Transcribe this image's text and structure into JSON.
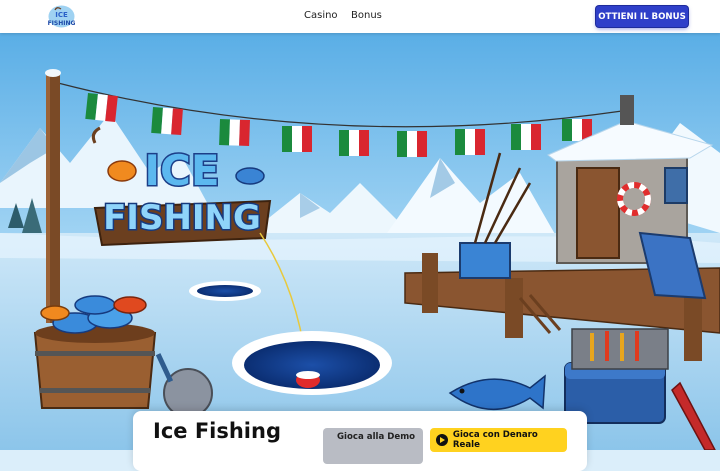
{
  "header": {
    "logo_text": "ICE FISHING",
    "nav": [
      {
        "label": "Casino"
      },
      {
        "label": "Bonus"
      }
    ],
    "cta_label": "OTTIENI IL BONUS"
  },
  "hero": {
    "game_logo_line1": "ICE",
    "game_logo_line2": "FISHING"
  },
  "card": {
    "title": "Ice Fishing",
    "demo_label": "Gioca alla Demo",
    "real_label": "Gioca con Denaro Reale"
  },
  "colors": {
    "brand_blue": "#2f3fc9",
    "cta_yellow": "#ffd21f",
    "flag_green": "#1b8a3d",
    "flag_red": "#d9262f",
    "ice": "#cfe8f8"
  },
  "icons": [
    "play-icon"
  ]
}
